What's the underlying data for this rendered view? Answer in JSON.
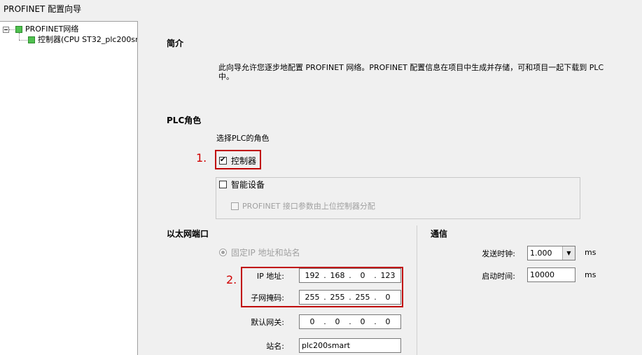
{
  "window": {
    "title": "PROFINET 配置向导"
  },
  "tree": {
    "root": "PROFINET网络",
    "child": "控制器(CPU ST32_plc200sm"
  },
  "intro": {
    "heading": "简介",
    "line1": "此向导允许您逐步地配置 PROFINET 网络。PROFINET 配置信息在项目中生成并存储，可和项目一起下载到 PLC",
    "line2": "中。"
  },
  "plc_role": {
    "heading": "PLC角色",
    "prompt": "选择PLC的角色",
    "controller_label": "控制器",
    "controller_checked": true,
    "smart_device_label": "智能设备",
    "smart_device_checked": false,
    "param_assign_label": "PROFINET 接口参数由上位控制器分配"
  },
  "ethernet": {
    "heading": "以太网端口",
    "radio_label": "固定IP 地址和站名",
    "ip_label": "IP 地址:",
    "ip": [
      "192",
      "168",
      "0",
      "123"
    ],
    "subnet_label": "子网掩码:",
    "subnet": [
      "255",
      "255",
      "255",
      "0"
    ],
    "gateway_label": "默认网关:",
    "gateway": [
      "0",
      "0",
      "0",
      "0"
    ],
    "station_label": "站名:",
    "station_value": "plc200smart"
  },
  "comm": {
    "heading": "通信",
    "send_clock_label": "发送时钟:",
    "send_clock_value": "1.000",
    "send_clock_unit": "ms",
    "startup_label": "启动时间:",
    "startup_value": "10000",
    "startup_unit": "ms"
  },
  "annotations": {
    "step1": "1.",
    "step2": "2."
  },
  "colors": {
    "highlight": "#c00000",
    "tree_node": "#4fc14f"
  }
}
